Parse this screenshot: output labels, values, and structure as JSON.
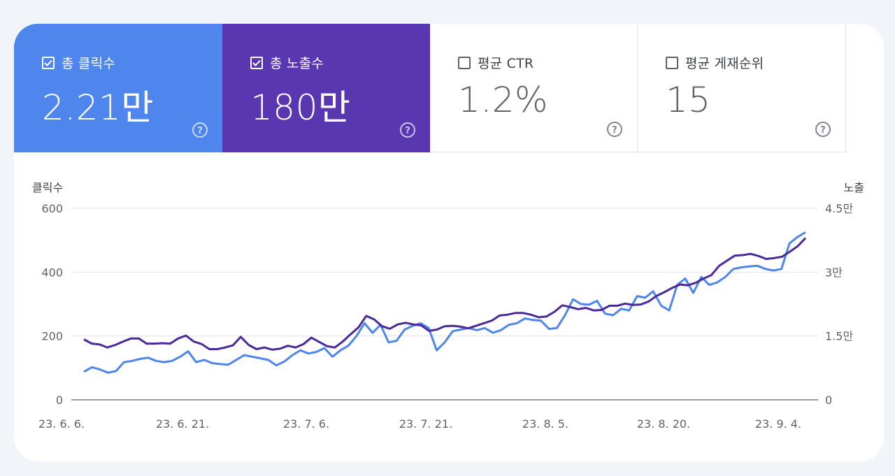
{
  "tiles": [
    {
      "label": "총 클릭수",
      "value": "2.21만",
      "checked": true,
      "color": "#4e86ee",
      "icon": "help-icon"
    },
    {
      "label": "총 노출수",
      "value": "180만",
      "checked": true,
      "color": "#5837b0",
      "icon": "help-icon"
    },
    {
      "label": "평균 CTR",
      "value": "1.2%",
      "checked": false,
      "color": "#ffffff",
      "icon": "help-icon"
    },
    {
      "label": "평균 게재순위",
      "value": "15",
      "checked": false,
      "color": "#ffffff",
      "icon": "help-icon"
    }
  ],
  "chart_data": {
    "type": "line",
    "ylabel": "클릭수",
    "y2label": "노출",
    "ylim": [
      0,
      600
    ],
    "y2lim": [
      0,
      45000
    ],
    "y_ticks": [
      "0",
      "200",
      "400",
      "600"
    ],
    "y2_ticks": [
      "0",
      "1.5만",
      "3만",
      "4.5만"
    ],
    "x_labels": [
      "23. 6. 6.",
      "23. 6. 21.",
      "23. 7. 6.",
      "23. 7. 21.",
      "23. 8. 5.",
      "23. 8. 20.",
      "23. 9. 4."
    ],
    "grid": true,
    "series": [
      {
        "name": "총 클릭수",
        "axis": "left",
        "color": "#4e86ee",
        "values": [
          88,
          102,
          95,
          85,
          90,
          118,
          122,
          128,
          132,
          122,
          118,
          122,
          135,
          152,
          118,
          125,
          115,
          112,
          110,
          125,
          140,
          135,
          130,
          125,
          108,
          120,
          140,
          155,
          145,
          150,
          162,
          135,
          155,
          170,
          200,
          240,
          210,
          235,
          180,
          185,
          220,
          232,
          240,
          225,
          155,
          180,
          215,
          220,
          225,
          218,
          225,
          210,
          218,
          235,
          240,
          255,
          250,
          248,
          222,
          225,
          265,
          315,
          300,
          298,
          310,
          270,
          265,
          285,
          280,
          325,
          320,
          340,
          295,
          280,
          360,
          380,
          335,
          385,
          360,
          368,
          385,
          410,
          415,
          418,
          420,
          410,
          405,
          410,
          490,
          510,
          525
        ]
      },
      {
        "name": "총 노출수",
        "axis": "right",
        "color": "#4a2a9a",
        "values": [
          14200,
          13200,
          13000,
          12300,
          12900,
          13700,
          14400,
          14400,
          13200,
          13200,
          13300,
          13200,
          14400,
          15100,
          13700,
          13100,
          11900,
          11900,
          12300,
          12800,
          14800,
          12900,
          11900,
          12300,
          11800,
          12000,
          12700,
          12300,
          13100,
          14600,
          13600,
          12600,
          12300,
          13700,
          15400,
          17000,
          19700,
          18900,
          17300,
          16700,
          17700,
          18100,
          17700,
          17500,
          16200,
          16500,
          17300,
          17400,
          17200,
          16800,
          17400,
          18000,
          18600,
          19800,
          20000,
          20400,
          20400,
          20000,
          19400,
          19600,
          20700,
          22200,
          21800,
          21300,
          21600,
          21000,
          21100,
          22100,
          22100,
          22600,
          22300,
          22400,
          23100,
          24400,
          25300,
          26300,
          27100,
          26900,
          27500,
          28500,
          29300,
          31500,
          32700,
          33900,
          34000,
          34300,
          33800,
          33100,
          33300,
          33600,
          34800,
          36100,
          38000
        ]
      }
    ]
  }
}
